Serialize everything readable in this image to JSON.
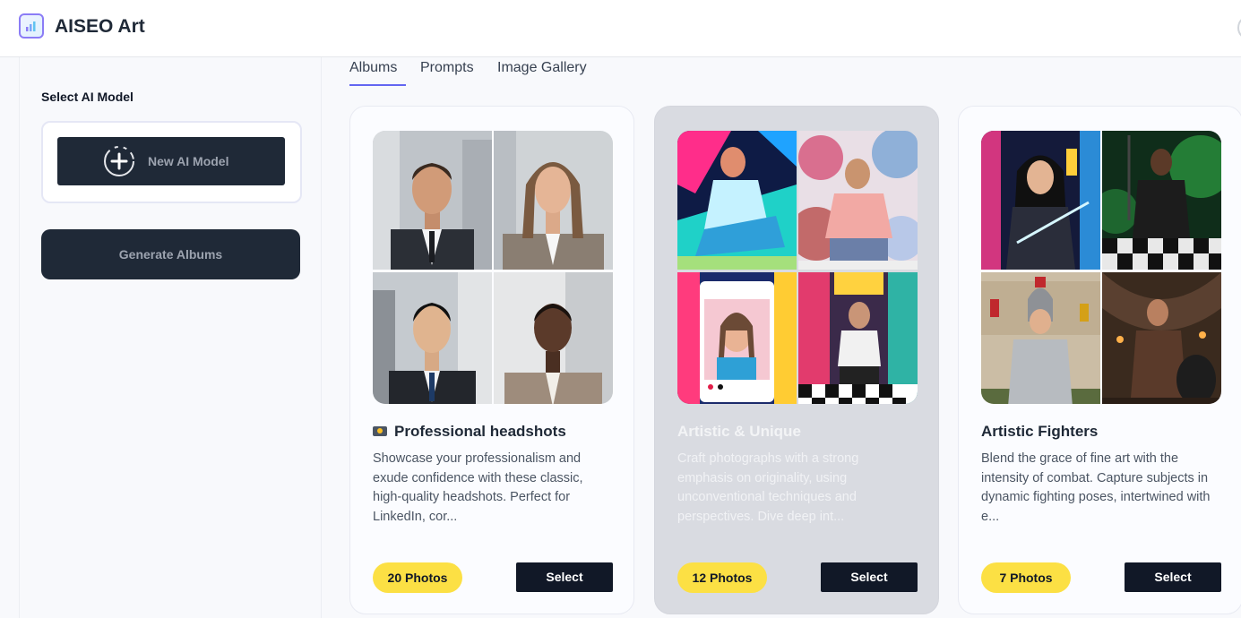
{
  "app": {
    "name": "AISEO Art"
  },
  "sidebar": {
    "title": "Select AI Model",
    "new_model_label": "New AI Model",
    "generate_label": "Generate Albums"
  },
  "tabs": [
    {
      "label": "Albums",
      "active": true
    },
    {
      "label": "Prompts",
      "active": false
    },
    {
      "label": "Image Gallery",
      "active": false
    }
  ],
  "cards": [
    {
      "title": "Professional headshots",
      "icon": "camera-icon",
      "description": "Showcase your professionalism and exude confidence with these classic, high-quality headshots. Perfect for LinkedIn, cor...",
      "photos": "20 Photos",
      "select_label": "Select",
      "active": false
    },
    {
      "title": "Artistic & Unique",
      "description": "Craft photographs with a strong emphasis on originality, using unconventional techniques and perspectives. Dive deep int...",
      "photos": "12 Photos",
      "select_label": "Select",
      "active": true
    },
    {
      "title": "Artistic Fighters",
      "description": "Blend the grace of fine art with the intensity of combat. Capture subjects in dynamic fighting poses, intertwined with e...",
      "photos": "7 Photos",
      "select_label": "Select",
      "active": false
    }
  ],
  "colors": {
    "accent": "#6366f1",
    "dark_button": "#1f2937",
    "badge": "#fce044"
  }
}
